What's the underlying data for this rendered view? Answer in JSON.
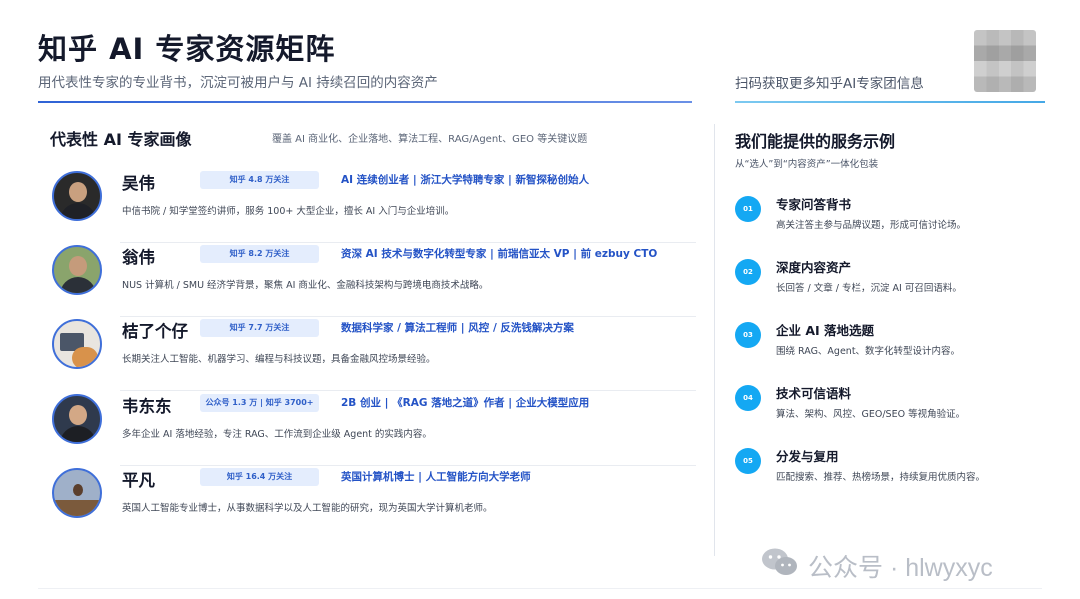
{
  "header": {
    "title": "知乎 AI 专家资源矩阵",
    "subtitle": "用代表性专家的专业背书，沉淀可被用户与 AI 持续召回的内容资产",
    "qr_caption": "扫码获取更多知乎AI专家团信息"
  },
  "experts_section": {
    "title": "代表性 AI 专家画像",
    "note": "覆盖 AI 商业化、企业落地、算法工程、RAG/Agent、GEO 等关键议题",
    "experts": [
      {
        "name": "吴伟",
        "badge": "知乎 4.8 万关注",
        "role": "AI 连续创业者 | 浙江大学特聘专家 | 新智探秘创始人",
        "desc": "中信书院 / 知学堂签约讲师，服务 100+ 大型企业，擅长 AI 入门与企业培训。"
      },
      {
        "name": "翁伟",
        "badge": "知乎 8.2 万关注",
        "role": "资深 AI 技术与数字化转型专家 | 前瑞信亚太 VP | 前 ezbuy CTO",
        "desc": "NUS 计算机 / SMU 经济学背景，聚焦 AI 商业化、金融科技架构与跨境电商技术战略。"
      },
      {
        "name": "桔了个仔",
        "badge": "知乎 7.7 万关注",
        "role": "数据科学家 / 算法工程师 | 风控 / 反洗钱解决方案",
        "desc": "长期关注人工智能、机器学习、编程与科技议题，具备金融风控场景经验。"
      },
      {
        "name": "韦东东",
        "badge": "公众号 1.3 万 | 知乎 3700+",
        "role": "2B 创业 | 《RAG 落地之道》作者 | 企业大模型应用",
        "desc": "多年企业 AI 落地经验，专注 RAG、工作流到企业级 Agent 的实践内容。"
      },
      {
        "name": "平凡",
        "badge": "知乎 16.4 万关注",
        "role": "英国计算机博士 | 人工智能方向大学老师",
        "desc": "英国人工智能专业博士，从事数据科学以及人工智能的研究，现为英国大学计算机老师。"
      }
    ]
  },
  "services_section": {
    "title": "我们能提供的服务示例",
    "subtitle": "从“选人”到“内容资产”一体化包装",
    "items": [
      {
        "num": "01",
        "label": "专家问答背书",
        "text": "高关注答主参与品牌议题，形成可信讨论场。"
      },
      {
        "num": "02",
        "label": "深度内容资产",
        "text": "长回答 / 文章 / 专栏，沉淀 AI 可召回语料。"
      },
      {
        "num": "03",
        "label": "企业 AI 落地选题",
        "text": "围绕 RAG、Agent、数字化转型设计内容。"
      },
      {
        "num": "04",
        "label": "技术可信语料",
        "text": "算法、架构、风控、GEO/SEO 等视角验证。"
      },
      {
        "num": "05",
        "label": "分发与复用",
        "text": "匹配搜索、推荐、热榜场景，持续复用优质内容。"
      }
    ]
  },
  "watermark": {
    "text": "公众号 · hlwyxyc",
    "icon": "wechat-icon"
  },
  "colors": {
    "accent_blue": "#2453c6",
    "badge_bg": "#e4edfd",
    "service_dot": "#14a8f3"
  }
}
